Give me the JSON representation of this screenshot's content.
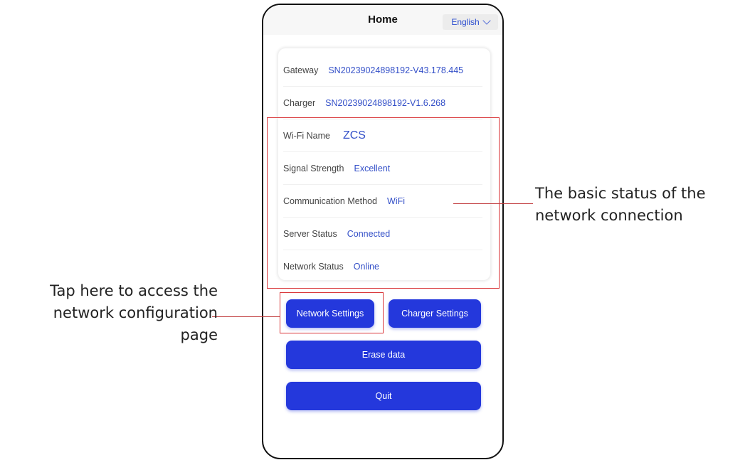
{
  "header": {
    "title": "Home",
    "language": "English"
  },
  "info": [
    {
      "label": "Gateway",
      "value": "SN20239024898192-V43.178.445"
    },
    {
      "label": "Charger",
      "value": "SN20239024898192-V1.6.268"
    },
    {
      "label": "Wi-Fi Name",
      "value": "ZCS"
    },
    {
      "label": "Signal Strength",
      "value": "Excellent"
    },
    {
      "label": "Communication Method",
      "value": "WiFi"
    },
    {
      "label": "Server Status",
      "value": "Connected"
    },
    {
      "label": "Network Status",
      "value": "Online"
    }
  ],
  "buttons": {
    "network_settings": "Network Settings",
    "charger_settings": "Charger Settings",
    "erase_data": "Erase data",
    "quit": "Quit"
  },
  "annotations": {
    "right_line1": "The basic status of the",
    "right_line2": "network connection",
    "left_line1": "Tap here to access the",
    "left_line2": "network configuration",
    "left_line3": "page"
  },
  "colors": {
    "accent": "#2438dc",
    "value_text": "#3450c8",
    "highlight_box": "#d9373a"
  }
}
